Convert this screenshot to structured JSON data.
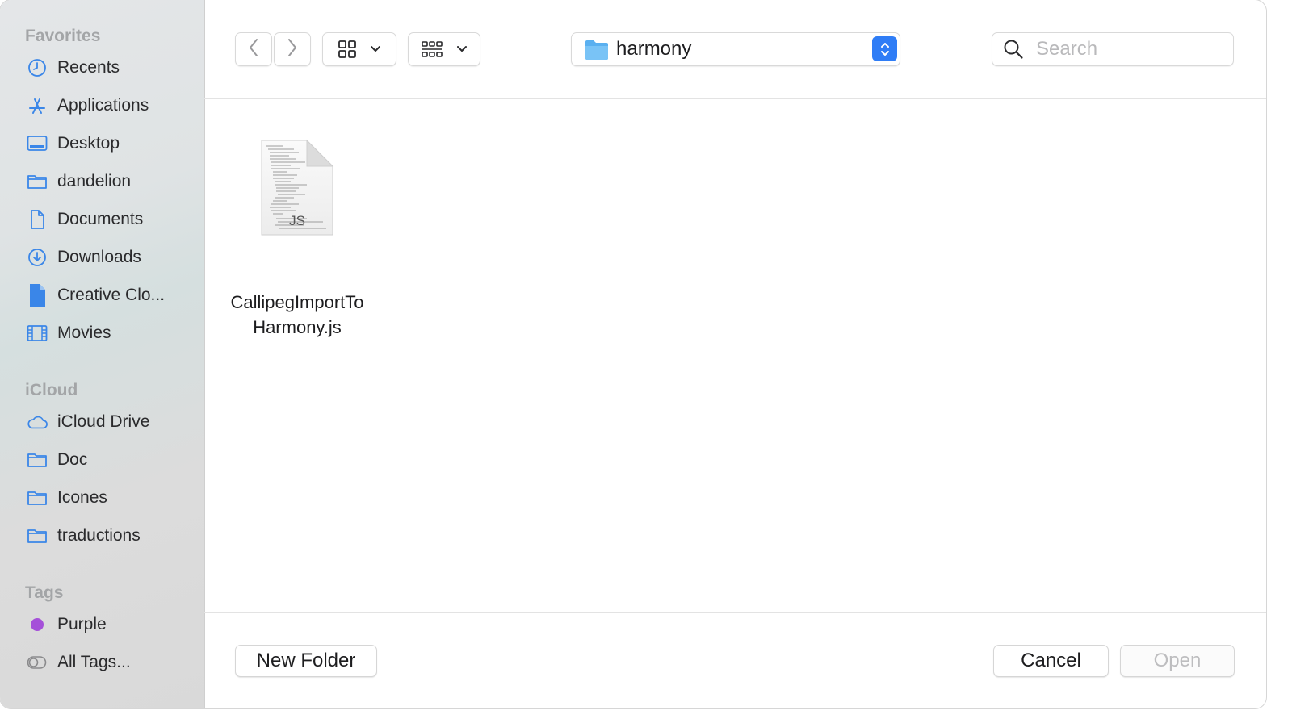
{
  "sidebar": {
    "favorites_title": "Favorites",
    "favorites": [
      {
        "label": "Recents",
        "icon": "clock-icon"
      },
      {
        "label": "Applications",
        "icon": "applications-icon"
      },
      {
        "label": "Desktop",
        "icon": "desktop-icon"
      },
      {
        "label": "dandelion",
        "icon": "folder-icon"
      },
      {
        "label": "Documents",
        "icon": "document-icon"
      },
      {
        "label": "Downloads",
        "icon": "download-icon"
      },
      {
        "label": "Creative Clo...",
        "icon": "file-icon"
      },
      {
        "label": "Movies",
        "icon": "film-icon"
      }
    ],
    "icloud_title": "iCloud",
    "icloud": [
      {
        "label": "iCloud Drive",
        "icon": "cloud-icon"
      },
      {
        "label": "Doc",
        "icon": "folder-icon"
      },
      {
        "label": "Icones",
        "icon": "folder-icon"
      },
      {
        "label": "traductions",
        "icon": "folder-icon"
      }
    ],
    "tags_title": "Tags",
    "tags": [
      {
        "label": "Purple",
        "icon": "purple-tag-icon",
        "color": "#a550d9"
      },
      {
        "label": "All Tags...",
        "icon": "all-tags-icon"
      }
    ]
  },
  "toolbar": {
    "location": "harmony",
    "search_placeholder": "Search"
  },
  "files": [
    {
      "name": "CallipegImportTo Harmony.js",
      "line1": "CallipegImportTo",
      "line2": "Harmony.js",
      "badge": "JS"
    }
  ],
  "footer": {
    "new_folder": "New Folder",
    "cancel": "Cancel",
    "open": "Open"
  },
  "colors": {
    "accent": "#2f7df6",
    "sidebar_icon": "#3a86e8",
    "folder": "#5ab0f0"
  }
}
